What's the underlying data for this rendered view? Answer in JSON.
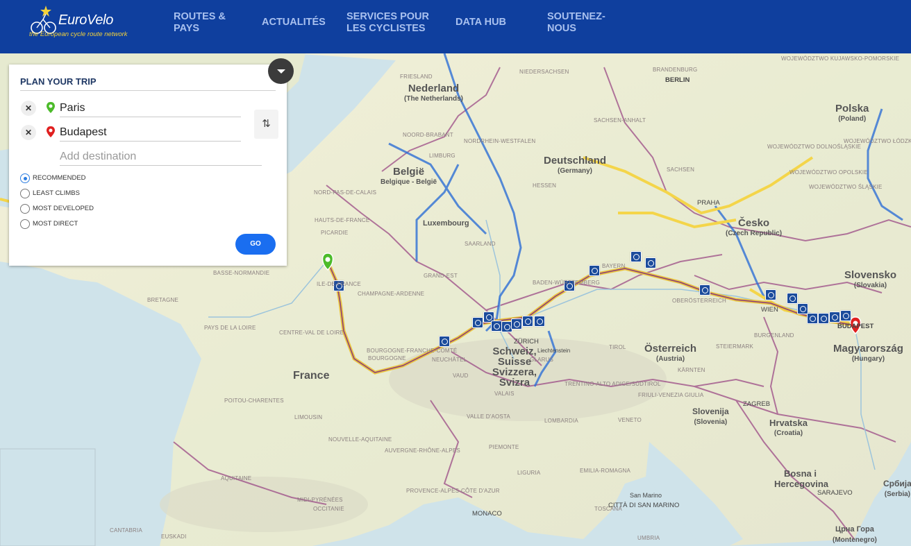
{
  "header": {
    "logo_word": "EuroVelo",
    "logo_tagline": "the European cycle route network",
    "nav": [
      {
        "label_line1": "ROUTES &",
        "label_line2": "PAYS"
      },
      {
        "label_line1": "ACTUALITÉS",
        "label_line2": ""
      },
      {
        "label_line1": "SERVICES POUR",
        "label_line2": "LES CYCLISTES"
      },
      {
        "label_line1": "DATA HUB",
        "label_line2": ""
      },
      {
        "label_line1": "SOUTENEZ-",
        "label_line2": "NOUS"
      }
    ],
    "colors": {
      "background": "#0f3f9e",
      "nav_text": "#a9c1ef",
      "tagline": "#f3d23b"
    }
  },
  "planner": {
    "title": "PLAN YOUR TRIP",
    "origin": "Paris",
    "destination": "Budapest",
    "add_destination_placeholder": "Add destination",
    "clear_icon": "close-icon",
    "swap_icon": "swap-vertical-icon",
    "options": [
      {
        "label": "RECOMMENDED",
        "selected": true
      },
      {
        "label": "LEAST CLIMBS",
        "selected": false
      },
      {
        "label": "MOST DEVELOPED",
        "selected": false
      },
      {
        "label": "MOST DIRECT",
        "selected": false
      }
    ],
    "go_label": "GO",
    "colors": {
      "go": "#1a6ef0",
      "origin_pin": "#4cbb2a",
      "destination_pin": "#e02020",
      "radio_selected": "#2b7de1"
    }
  },
  "map": {
    "countries": [
      {
        "name": "Nederland",
        "local": "(The Netherlands)"
      },
      {
        "name": "Deutschland",
        "local": "(Germany)"
      },
      {
        "name": "Polska",
        "local": "(Poland)"
      },
      {
        "name": "België",
        "local": "Belgique - België"
      },
      {
        "name": "Luxembourg",
        "local": ""
      },
      {
        "name": "Česko",
        "local": "(Czech Republic)"
      },
      {
        "name": "Slovensko",
        "local": "(Slovakia)"
      },
      {
        "name": "France",
        "local": ""
      },
      {
        "name": "Schweiz, Suisse Svizzera, Svizra",
        "local": ""
      },
      {
        "name": "Österreich",
        "local": "(Austria)"
      },
      {
        "name": "Magyarország",
        "local": "(Hungary)"
      },
      {
        "name": "Slovenija",
        "local": "(Slovenia)"
      },
      {
        "name": "Hrvatska",
        "local": "(Croatia)"
      },
      {
        "name": "Bosna i Hercegovina",
        "local": ""
      },
      {
        "name": "Црна Гора",
        "local": "(Montenegro)"
      },
      {
        "name": "Србија",
        "local": "(Serbia)"
      }
    ],
    "regions": [
      "FRIESLAND",
      "NIEDERSACHSEN",
      "BRANDENBURG",
      "SACHSEN-ANHALT",
      "NORDRHEIN-WESTFALEN",
      "HESSEN",
      "SACHSEN",
      "NOORD-BRABANT",
      "LIMBURG",
      "NORD-PAS-DE-CALAIS",
      "HAUTS-DE-FRANCE",
      "PICARDIE",
      "SAARLAND",
      "GRAND-EST",
      "BADEN-WÜRTTEMBERG",
      "BAYERN",
      "OBERÖSTERREICH",
      "BASSE-NORMANDIE",
      "ILE-DE-FRANCE",
      "CHAMPAGNE-ARDENNE",
      "BRETAGNE",
      "PAYS DE LA LOIRE",
      "CENTRE-VAL DE LOIRE",
      "BOURGOGNE-FRANCHE-COMTÉ",
      "BOURGOGNE",
      "POITOU-CHARENTES",
      "LIMOUSIN",
      "NOUVELLE-AQUITAINE",
      "AQUITAINE",
      "OCCITANIE",
      "MIDI-PYRÉNÉES",
      "AUVERGNE-RHÔNE-ALPES",
      "PROVENCE-ALPES-CÔTE D'AZUR",
      "PIEMONTE",
      "LOMBARDIA",
      "LIGURIA",
      "EMILIA-ROMAGNA",
      "TOSCANA",
      "UMBRIA",
      "VALLE D'AOSTA",
      "TIROL",
      "STEIERMARK",
      "KÄRNTEN",
      "TRENTINO-ALTO ADIGE/SÜDTIROL",
      "FRIULI-VENEZIA GIULIA",
      "VENETO",
      "BURGENLAND",
      "WOJEWÓDZTWO DOLNOŚLĄSKIE",
      "WOJEWÓDZTWO ŁÓDZKIE",
      "WOJEWÓDZTWO OPOLSKIE",
      "WOJEWÓDZTWO ŚLĄSKIE",
      "WOJEWÓDZTWO KUJAWSKO-POMORSKIE",
      "VAUD",
      "NEUCHÂTEL",
      "GLARUS",
      "VALAIS",
      "CANTABRIA",
      "EUSKADI"
    ],
    "cities": [
      "BERLIN",
      "PRAHA",
      "WIEN",
      "BUDAPEST",
      "ZAGREB",
      "SARAJEVO",
      "MONACO",
      "ZÜRICH",
      "Liechtenstein",
      "San Marino",
      "CITTÀ DI SAN MARINO"
    ],
    "route_colors": {
      "eurovelo_main": "#f4d54a",
      "eurovelo_alt": "#2e6fd6",
      "border": "#8e2c6b"
    }
  }
}
